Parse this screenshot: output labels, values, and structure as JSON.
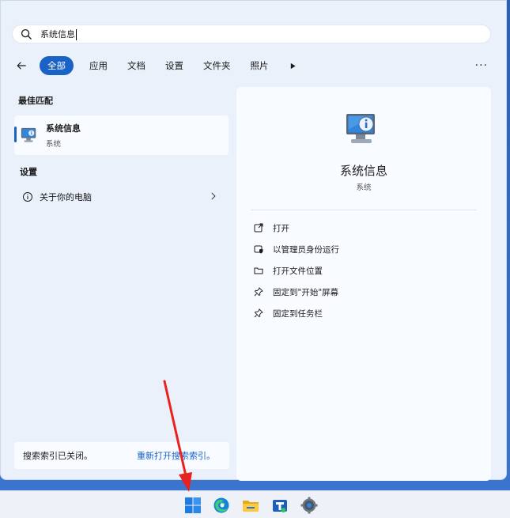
{
  "search": {
    "value": "系统信息"
  },
  "filters": {
    "items": [
      "全部",
      "应用",
      "文档",
      "设置",
      "文件夹",
      "照片"
    ],
    "active_index": 0,
    "ellipsis": "···"
  },
  "best_match": {
    "section_title": "最佳匹配",
    "name": "系统信息",
    "type": "系统"
  },
  "settings_section": {
    "title": "设置",
    "item_label": "关于你的电脑"
  },
  "notice": {
    "message": "搜索索引已关闭。",
    "link": "重新打开搜索索引。"
  },
  "detail": {
    "title": "系统信息",
    "subtitle": "系统",
    "actions": [
      "打开",
      "以管理员身份运行",
      "打开文件位置",
      "固定到\"开始\"屏幕",
      "固定到任务栏"
    ]
  },
  "colors": {
    "accent": "#1a62c6",
    "arrow": "#e8231f"
  },
  "icons": {
    "search": "search-icon",
    "back": "arrow-left-icon",
    "more": "play-icon",
    "info": "info-circle-icon",
    "chevron": "chevron-right-icon",
    "taskbar": [
      "windows-start-icon",
      "edge-icon",
      "file-explorer-icon",
      "store-icon",
      "settings-icon"
    ]
  }
}
